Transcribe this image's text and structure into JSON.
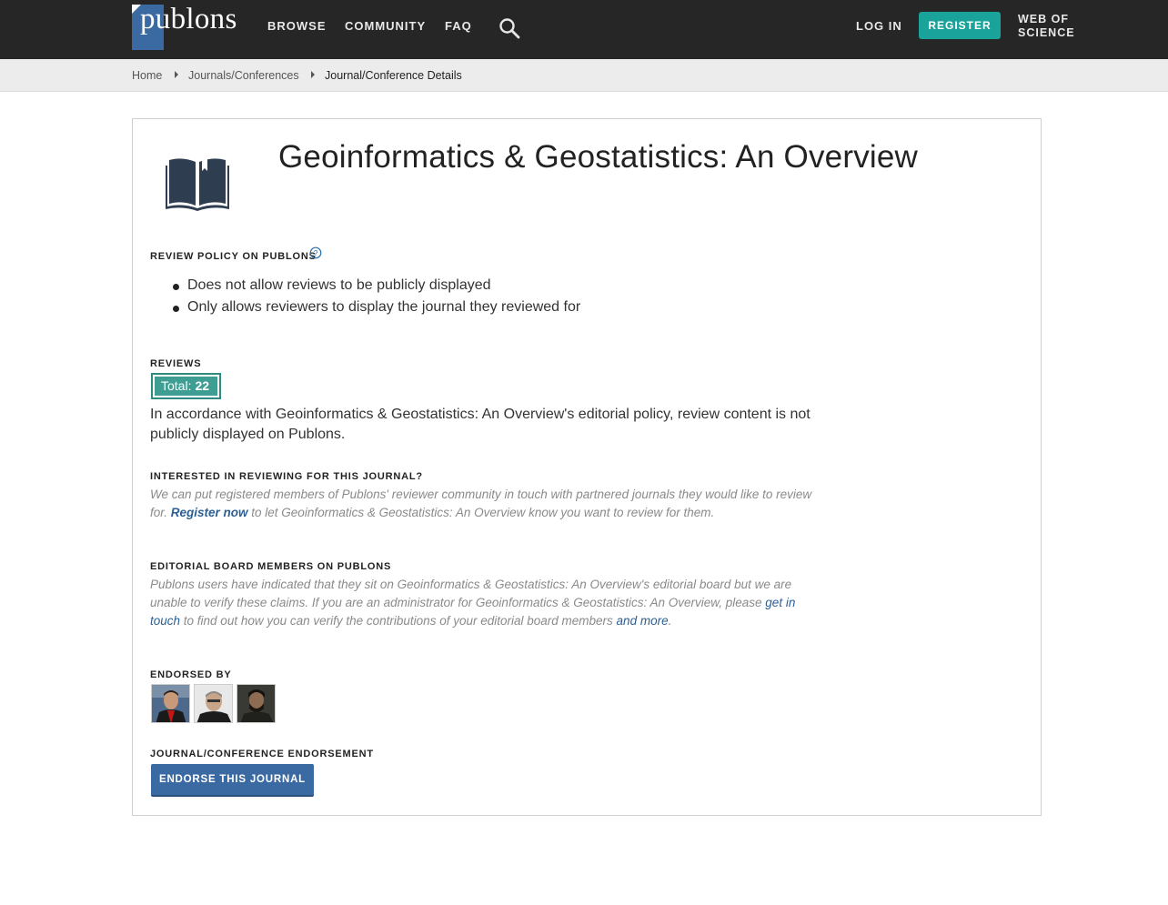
{
  "header": {
    "logo_text": "publons",
    "nav": [
      "BROWSE",
      "COMMUNITY",
      "FAQ"
    ],
    "login_label": "LOG IN",
    "register_label": "REGISTER",
    "wos_line1": "WEB OF",
    "wos_line2": "SCIENCE"
  },
  "breadcrumb": {
    "home": "Home",
    "journals": "Journals/Conferences",
    "current": "Journal/Conference Details"
  },
  "journal": {
    "title": "Geoinformatics & Geostatistics: An Overview"
  },
  "review_policy": {
    "heading": "REVIEW POLICY ON PUBLONS",
    "items": [
      "Does not allow reviews to be publicly displayed",
      "Only allows reviewers to display the journal they reviewed for"
    ]
  },
  "reviews": {
    "heading": "REVIEWS",
    "total_label": "Total:",
    "total_value": "22",
    "notice": "In accordance with Geoinformatics & Geostatistics: An Overview's editorial policy, review content is not publicly displayed on Publons."
  },
  "interested": {
    "heading": "INTERESTED IN REVIEWING FOR THIS JOURNAL?",
    "text_before": "We can put registered members of Publons' reviewer community in touch with partnered journals they would like to review for. ",
    "link": "Register now",
    "text_after": " to let Geoinformatics & Geostatistics: An Overview know you want to review for them."
  },
  "editorial": {
    "heading": "EDITORIAL BOARD MEMBERS ON PUBLONS",
    "text_before": "Publons users have indicated that they sit on Geoinformatics & Geostatistics: An Overview's editorial board but we are unable to verify these claims. If you are an administrator for Geoinformatics & Geostatistics: An Overview, please ",
    "link1": "get in touch",
    "text_middle": " to find out how you can verify the contributions of your editorial board members ",
    "link2": "and more",
    "text_end": "."
  },
  "endorsed_by": {
    "heading": "ENDORSED BY"
  },
  "endorsement": {
    "heading": "JOURNAL/CONFERENCE ENDORSEMENT",
    "button": "ENDORSE THIS JOURNAL"
  },
  "colors": {
    "topbar": "#262626",
    "accent_teal": "#1aa39a",
    "brand_blue": "#3a6aa1",
    "link_blue": "#2c5f94"
  }
}
